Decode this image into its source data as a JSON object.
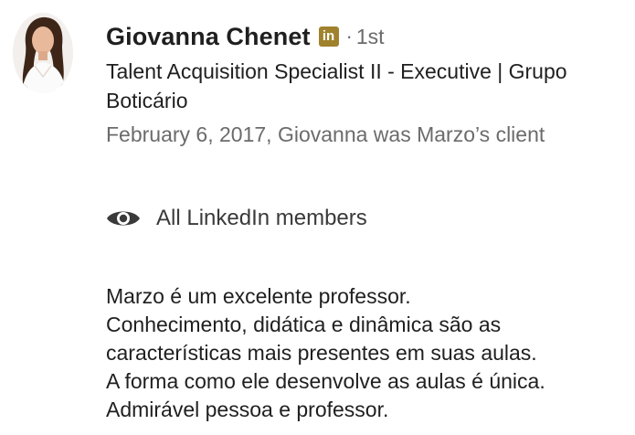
{
  "recommender": {
    "name": "Giovanna Chenet",
    "badge_icon": "linkedin-premium-icon",
    "badge_text": "in",
    "separator": "·",
    "degree": "1st",
    "headline": "Talent Acquisition Specialist II - Executive | Grupo Boticário",
    "relationship": "February 6, 2017, Giovanna was Marzo’s client"
  },
  "visibility": {
    "icon": "eye-icon",
    "label": "All LinkedIn members"
  },
  "recommendation": {
    "lines": [
      "Marzo é um excelente professor.",
      "Conhecimento, didática e dinâmica são as",
      "características mais presentes em suas aulas.",
      "A forma como ele desenvolve as aulas é única.",
      "Admirável pessoa e professor."
    ]
  },
  "colors": {
    "badge": "#a0822d",
    "secondary_text": "#6b6b6b",
    "primary_text": "#1f1f1f"
  }
}
